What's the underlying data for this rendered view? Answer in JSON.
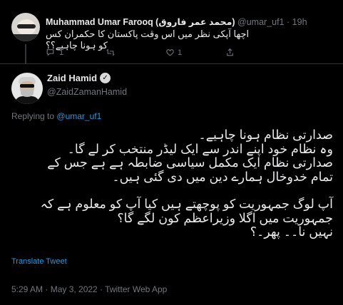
{
  "reply_tweet": {
    "display_name": "Muhammad Umar Farooq (محمد عمر فاروق)",
    "handle": "@umar_uf1",
    "separator": "·",
    "time": "19h",
    "text": "اچھا آپکی نظر میں اس وقت پاکستان کا حکمران کس کو ہونا چاہیے؟؟",
    "reply_count": "1",
    "retweet_count": "",
    "like_count": "1"
  },
  "main_tweet": {
    "display_name": "Zaid Hamid",
    "verified_mark": "✓",
    "handle": "@ZaidZamanHamid",
    "replying_prefix": "Replying to",
    "replying_to": "@umar_uf1",
    "lines": [
      "صدارتی نظام ہونا چاہیے۔",
      "وہ نظام خود اپنے اندر سے ایک لیڈر منتخب کر لے گا۔",
      "صدارتی نظام ایک مکمل سیاسی ضابطہ ہے ہے جس کے",
      "تمام خدوخال ہمارے دین میں دی گئی ہیں۔",
      "آپ لوگ جمہوریت کو پوچھتے ہیں کیا آپ کو معلوم ہے کہ",
      "جمہوریت میں اگلا وزیراعظم کون لگے گا؟",
      "نہیں نا۔۔ پھر۔؟"
    ],
    "translate_label": "Translate Tweet",
    "timestamp": "5:29 AM · May 3, 2022 · Twitter Web App"
  },
  "icons": {
    "reply": "reply-icon",
    "retweet": "retweet-icon",
    "like": "heart-icon",
    "share": "share-icon"
  },
  "colors": {
    "background": "#000000",
    "text": "#e7e9ea",
    "muted": "#71767b",
    "link": "#1d9bf0",
    "divider": "#2f3336"
  }
}
